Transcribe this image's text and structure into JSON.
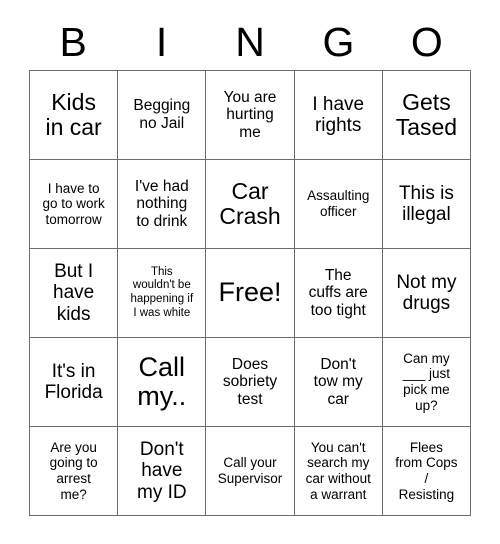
{
  "card": {
    "header_letters": [
      "B",
      "I",
      "N",
      "G",
      "O"
    ],
    "columns": 5,
    "rows": 5,
    "grid_line_color": "#6d6d6d",
    "background_color": "#ffffff",
    "text_color": "#000000",
    "cells": [
      [
        {
          "text": "Kids\nin car",
          "size": "xl"
        },
        {
          "text": "Begging\nno Jail",
          "size": "m"
        },
        {
          "text": "You are\nhurting\nme",
          "size": "m"
        },
        {
          "text": "I have\nrights",
          "size": "l"
        },
        {
          "text": "Gets\nTased",
          "size": "xl"
        }
      ],
      [
        {
          "text": "I have to\ngo to work\ntomorrow",
          "size": "s"
        },
        {
          "text": "I've had\nnothing\nto drink",
          "size": "m"
        },
        {
          "text": "Car\nCrash",
          "size": "xl"
        },
        {
          "text": "Assaulting\nofficer",
          "size": "s"
        },
        {
          "text": "This is\nillegal",
          "size": "l"
        }
      ],
      [
        {
          "text": "But I\nhave\nkids",
          "size": "l"
        },
        {
          "text": "This\nwouldn't be\nhappening if\nI was white",
          "size": "xs"
        },
        {
          "text": "Free!",
          "size": "xxl"
        },
        {
          "text": "The\ncuffs are\ntoo tight",
          "size": "m"
        },
        {
          "text": "Not my\ndrugs",
          "size": "l"
        }
      ],
      [
        {
          "text": "It's in\nFlorida",
          "size": "l"
        },
        {
          "text": "Call\nmy..",
          "size": "xxl"
        },
        {
          "text": "Does\nsobriety\ntest",
          "size": "m"
        },
        {
          "text": "Don't\ntow my\ncar",
          "size": "m"
        },
        {
          "text": "Can my\n___ just\npick me\nup?",
          "size": "s"
        }
      ],
      [
        {
          "text": "Are you\ngoing to\narrest\nme?",
          "size": "s"
        },
        {
          "text": "Don't\nhave\nmy ID",
          "size": "l"
        },
        {
          "text": "Call your\nSupervisor",
          "size": "s"
        },
        {
          "text": "You can't\nsearch my\ncar without\na warrant",
          "size": "s"
        },
        {
          "text": "Flees\nfrom Cops\n/\nResisting",
          "size": "s"
        }
      ]
    ]
  }
}
